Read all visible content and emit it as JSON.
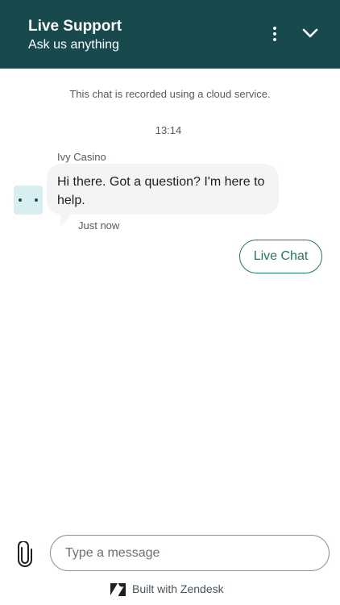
{
  "header": {
    "title": "Live Support",
    "subtitle": "Ask us anything",
    "menu_icon": "more-vertical-icon",
    "collapse_icon": "chevron-down-icon",
    "background": "#17494d"
  },
  "conversation": {
    "notice": "This chat is recorded using a cloud service.",
    "time": "13:14",
    "messages": [
      {
        "sender": "Ivy Casino",
        "text": "Hi there. Got a question? I'm here to help.",
        "status": "Just now",
        "avatar_icon": "bot-avatar-icon"
      }
    ],
    "quick_replies": [
      "Live Chat"
    ]
  },
  "composer": {
    "attach_icon": "paperclip-icon",
    "placeholder": "Type a message",
    "value": ""
  },
  "footer": {
    "logo_icon": "zendesk-logo-icon",
    "text": "Built with Zendesk"
  },
  "colors": {
    "accent": "#1f7a5c",
    "bubble": "#f3f4f5",
    "avatar_bg": "#d9eef1"
  }
}
